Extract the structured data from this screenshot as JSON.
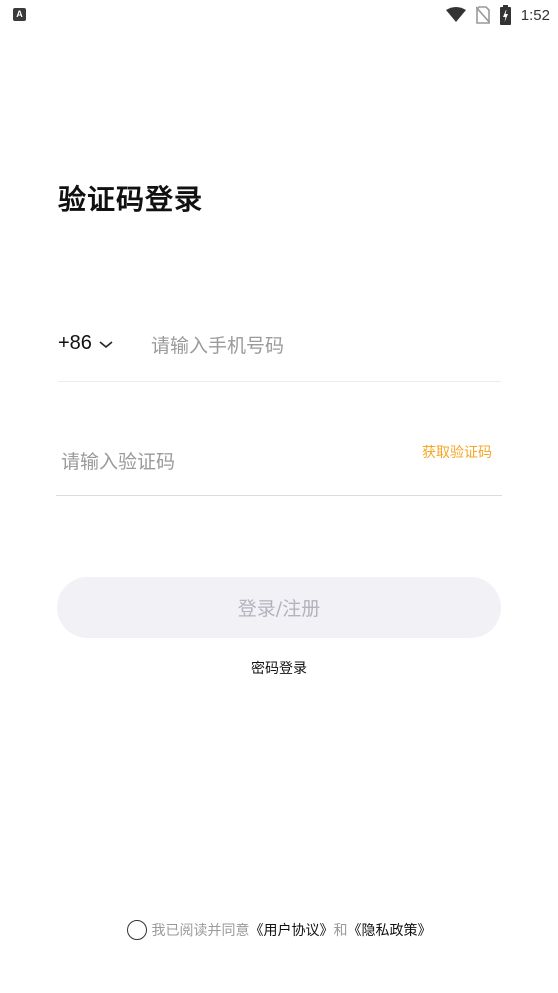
{
  "status_bar": {
    "left_icon": "A",
    "icons": [
      "wifi-icon",
      "no-sim-icon",
      "battery-charging-icon"
    ],
    "time": "1:52"
  },
  "title": "验证码登录",
  "phone": {
    "country_code": "+86",
    "placeholder": "请输入手机号码",
    "value": ""
  },
  "code": {
    "placeholder": "请输入验证码",
    "value": "",
    "get_code_label": "获取验证码"
  },
  "login_button": "登录/注册",
  "password_login": "密码登录",
  "agreement": {
    "checked": false,
    "prefix": "我已阅读并同意",
    "user_agreement": "《用户协议》",
    "and": "和",
    "privacy_policy": "《隐私政策》"
  },
  "colors": {
    "accent": "#f5a623",
    "button_bg": "#f1f1f6",
    "button_text": "#b3b3bd",
    "placeholder": "#9a9a9a"
  }
}
